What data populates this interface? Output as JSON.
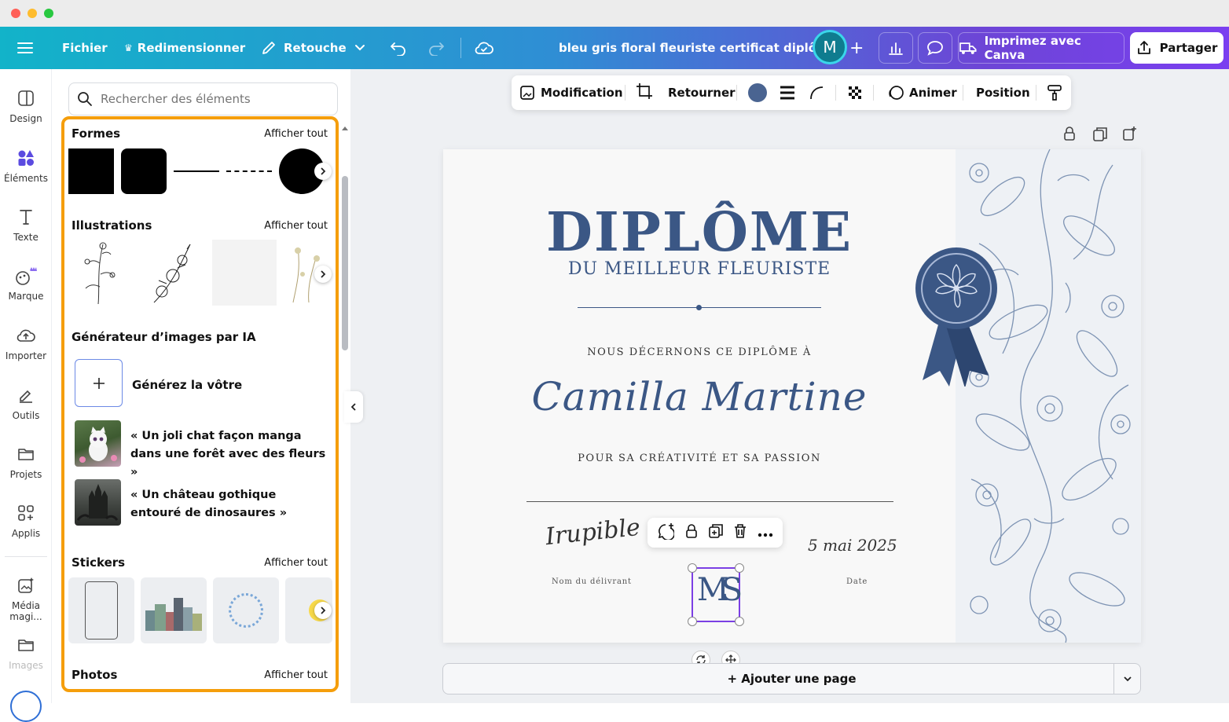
{
  "window": {
    "traffic_lights": [
      "#ff5f57",
      "#febc2e",
      "#28c840"
    ]
  },
  "topbar": {
    "menu_icon": "hamburger-icon",
    "file": "Fichier",
    "resize": "Redimensionner",
    "retouch": "Retouche",
    "doc_title": "bleu gris floral fleuriste certificat diplôme",
    "avatar_letter": "M",
    "print": "Imprimez avec Canva",
    "share": "Partager"
  },
  "sidebar": {
    "items": [
      {
        "label": "Design",
        "icon": "design-icon"
      },
      {
        "label": "Éléments",
        "icon": "elements-icon"
      },
      {
        "label": "Texte",
        "icon": "text-icon"
      },
      {
        "label": "Marque",
        "icon": "brand-icon"
      },
      {
        "label": "Importer",
        "icon": "upload-cloud-icon"
      },
      {
        "label": "Outils",
        "icon": "tools-icon"
      },
      {
        "label": "Projets",
        "icon": "folder-icon"
      },
      {
        "label": "Applis",
        "icon": "apps-icon"
      },
      {
        "label": "Média magi...",
        "icon": "magic-media-icon"
      },
      {
        "label": "Images",
        "icon": "folder-icon"
      }
    ]
  },
  "panel": {
    "search_placeholder": "Rechercher des éléments",
    "shapes": {
      "title": "Formes",
      "see_all": "Afficher tout"
    },
    "illustrations": {
      "title": "Illustrations",
      "see_all": "Afficher tout"
    },
    "ai_generator": {
      "title": "Générateur d’images par IA",
      "generate": "Générez la vôtre",
      "prompts": [
        "« Un joli chat façon manga dans une forêt avec des fleurs »",
        "« Un château gothique entouré de dinosaures »"
      ]
    },
    "stickers": {
      "title": "Stickers",
      "see_all": "Afficher tout"
    },
    "photos": {
      "title": "Photos",
      "see_all": "Afficher tout"
    }
  },
  "toolbar": {
    "edit": "Modification",
    "flip": "Retourner",
    "color": "#4a6491",
    "animate": "Animer",
    "position": "Position"
  },
  "certificate": {
    "title": "DIPLÔME",
    "subtitle": "DU MEILLEUR FLEURISTE",
    "awarded": "NOUS DÉCERNONS CE DIPLÔME À",
    "recipient": "Camilla Martine",
    "reason": "POUR SA CRÉATIVITÉ ET SA PASSION",
    "signature": "Irupible",
    "issuer_label": "Nom du délivrant",
    "date": "5 mai 2025",
    "date_label": "Date",
    "monogram": "MS",
    "accent": "#3b5785"
  },
  "bottom": {
    "add_page": "+ Ajouter une page"
  }
}
